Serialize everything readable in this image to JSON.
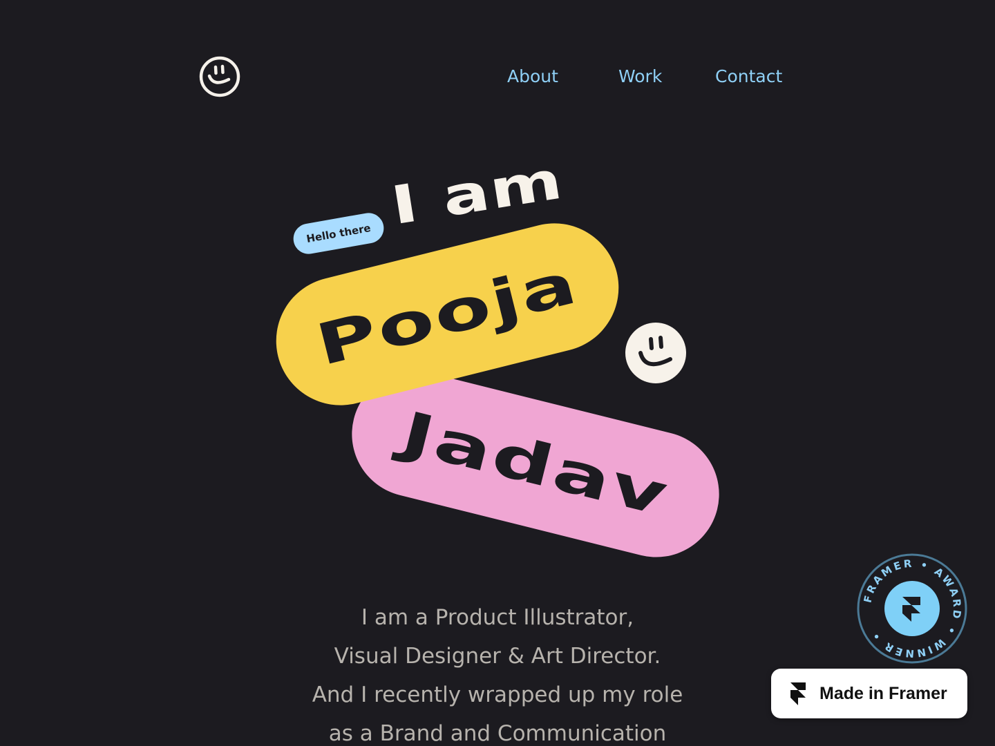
{
  "colors": {
    "background": "#1c1b20",
    "nav_link": "#8fd0f6",
    "pill_pooja": "#f7d14c",
    "pill_jadav": "#f0a6d3",
    "chip": "#a9dcff",
    "award_ring": "#4b7a96",
    "award_center": "#7fd0f7",
    "text_muted": "#b7b3ad"
  },
  "header": {
    "logo_icon": "smiley-logo-icon",
    "nav": [
      {
        "label": "About"
      },
      {
        "label": "Work"
      },
      {
        "label": "Contact"
      }
    ]
  },
  "hero": {
    "chip": "Hello there",
    "iam": "I am",
    "first_name": "Pooja",
    "last_name": "Jadav",
    "decor_icon": "smiley-icon"
  },
  "intro": {
    "lines": [
      "I am a Product Illustrator,",
      "Visual Designer & Art Director.",
      "And I recently wrapped up my role",
      "as a Brand and Communication"
    ]
  },
  "award": {
    "text": "FRAMER • AWARD • WINNER •",
    "icon": "framer-icon"
  },
  "badge": {
    "label": "Made in Framer",
    "icon": "framer-icon"
  }
}
